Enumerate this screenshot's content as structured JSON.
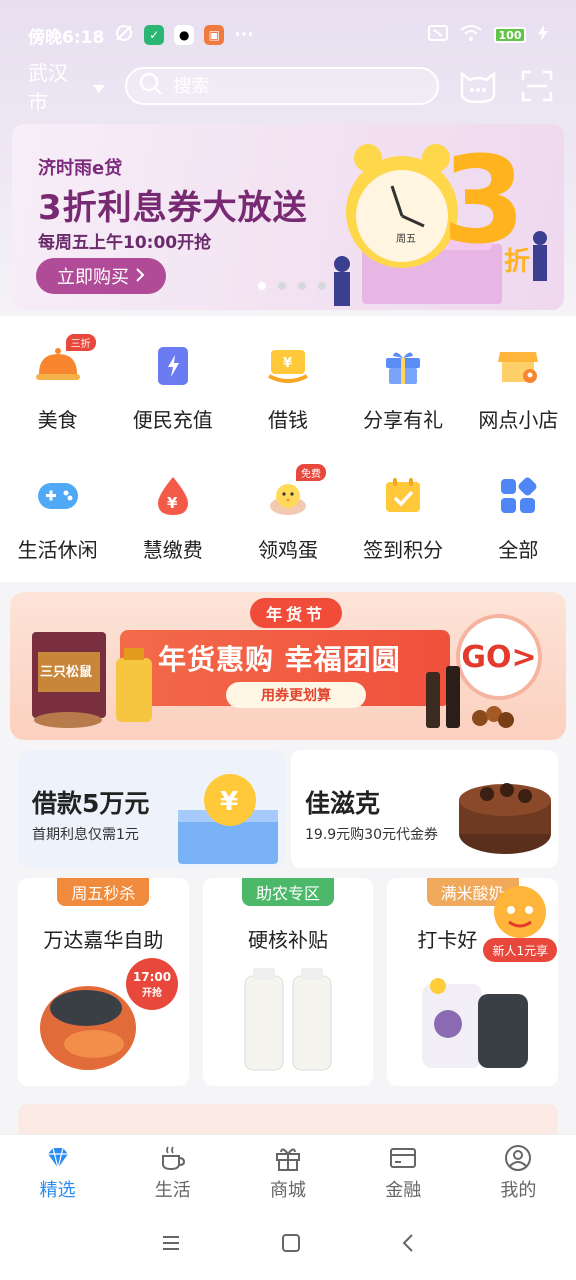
{
  "status_bar": {
    "time": "傍晚6:18",
    "battery": "100",
    "more": "···"
  },
  "header": {
    "city": "武汉市",
    "search_placeholder": "搜索"
  },
  "banner": {
    "brand": "济时雨e贷",
    "title": "3折利息券大放送",
    "subtitle": "每周五上午10:00开抢",
    "button": "立即购买",
    "art_number": "3",
    "art_unit": "折",
    "clock_label": "周五"
  },
  "grid": [
    {
      "label": "美食",
      "icon": "food-cloche-icon",
      "tag": "三折"
    },
    {
      "label": "便民充值",
      "icon": "phone-charge-icon"
    },
    {
      "label": "借钱",
      "icon": "loan-icon"
    },
    {
      "label": "分享有礼",
      "icon": "gift-icon"
    },
    {
      "label": "网点小店",
      "icon": "shop-icon"
    },
    {
      "label": "生活休闲",
      "icon": "gamepad-icon"
    },
    {
      "label": "慧缴费",
      "icon": "payment-drop-icon"
    },
    {
      "label": "领鸡蛋",
      "icon": "chick-icon",
      "tag": "免费"
    },
    {
      "label": "签到积分",
      "icon": "checkin-calendar-icon"
    },
    {
      "label": "全部",
      "icon": "all-apps-icon"
    }
  ],
  "promo": {
    "tag": "年货节",
    "title": "年货惠购 幸福团圆",
    "subtitle": "用券更划算",
    "go": "GO>",
    "product_text": "三只松鼠"
  },
  "cards": [
    {
      "title": "借款5万元",
      "subtitle": "首期利息仅需1元"
    },
    {
      "title": "佳滋克",
      "subtitle": "19.9元购30元代金券"
    }
  ],
  "deals": [
    {
      "tag": "周五秒杀",
      "title": "万达嘉华自助",
      "tag_color": "#f08a3c",
      "badge_time": "17:00",
      "badge_text": "开抢"
    },
    {
      "tag": "助农专区",
      "title": "硬核补贴",
      "tag_color": "#4bb86a"
    },
    {
      "tag": "满米酸奶",
      "title": "打卡好",
      "tag_color": "#f0a85a",
      "promo_badge": "新人1元享"
    }
  ],
  "bottom_nav": [
    {
      "label": "精选",
      "icon": "diamond-icon",
      "active": true
    },
    {
      "label": "生活",
      "icon": "coffee-cup-icon"
    },
    {
      "label": "商城",
      "icon": "gift-box-icon"
    },
    {
      "label": "金融",
      "icon": "card-icon"
    },
    {
      "label": "我的",
      "icon": "profile-icon"
    }
  ],
  "colors": {
    "accent": "#2a8cf0",
    "banner_title": "#772a72",
    "banner_button": "#b04b98",
    "promo_red": "#f0513c"
  }
}
